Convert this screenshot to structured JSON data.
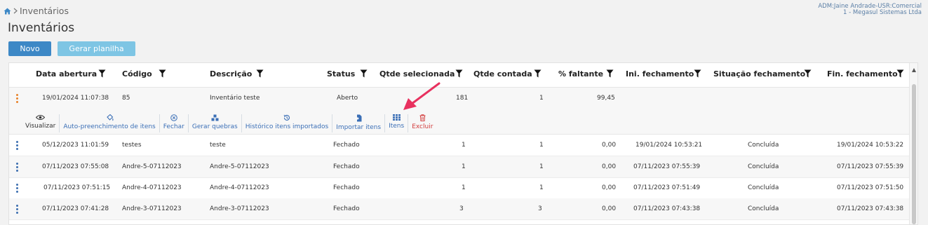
{
  "breadcrumb": {
    "page": "Inventários"
  },
  "user": {
    "line1": "ADM:Jaine Andrade-USR:Comercial",
    "line2": "1 - Megasul Sistemas Ltda"
  },
  "page_title": "Inventários",
  "buttons": {
    "novo": "Novo",
    "gerar_planilha": "Gerar planilha"
  },
  "table": {
    "columns": [
      "Data abertura",
      "Código",
      "Descrição",
      "Status",
      "Qtde selecionada",
      "Qtde contada",
      "% faltante",
      "Ini. fechamento",
      "Situação fechamento",
      "Fin. fechamento"
    ],
    "expanded_row": {
      "data_abertura": "19/01/2024 11:07:38",
      "codigo": "85",
      "descricao": "Inventário teste",
      "status": "Aberto",
      "qtde_selecionada": "181",
      "qtde_contada": "1",
      "faltante": "99,45",
      "actions": [
        "Visualizar",
        "Auto-preenchimento de itens",
        "Fechar",
        "Gerar quebras",
        "Histórico itens importados",
        "Importar itens",
        "Itens",
        "Excluir"
      ]
    },
    "rows": [
      {
        "data_abertura": "05/12/2023 11:01:59",
        "codigo": "testes",
        "descricao": "teste",
        "status": "Fechado",
        "qtde_selecionada": "1",
        "qtde_contada": "1",
        "faltante": "0,00",
        "ini_fechamento": "19/01/2024 10:53:21",
        "situacao": "Concluída",
        "fin_fechamento": "19/01/2024 10:53:22"
      },
      {
        "data_abertura": "07/11/2023 07:55:08",
        "codigo": "Andre-5-07112023",
        "descricao": "Andre-5-07112023",
        "status": "Fechado",
        "qtde_selecionada": "1",
        "qtde_contada": "1",
        "faltante": "0,00",
        "ini_fechamento": "07/11/2023 07:55:39",
        "situacao": "Concluída",
        "fin_fechamento": "07/11/2023 07:55:39"
      },
      {
        "data_abertura": "07/11/2023 07:51:15",
        "codigo": "Andre-4-07112023",
        "descricao": "Andre-4-07112023",
        "status": "Fechado",
        "qtde_selecionada": "1",
        "qtde_contada": "1",
        "faltante": "0,00",
        "ini_fechamento": "07/11/2023 07:51:49",
        "situacao": "Concluída",
        "fin_fechamento": "07/11/2023 07:51:50"
      },
      {
        "data_abertura": "07/11/2023 07:41:28",
        "codigo": "Andre-3-07112023",
        "descricao": "Andre-3-07112023",
        "status": "Fechado",
        "qtde_selecionada": "3",
        "qtde_contada": "3",
        "faltante": "0,00",
        "ini_fechamento": "07/11/2023 07:43:38",
        "situacao": "Concluída",
        "fin_fechamento": "07/11/2023 07:43:38"
      }
    ]
  },
  "colors": {
    "primary": "#3d88c6",
    "secondary": "#7ec5e4",
    "link": "#3b6fb6",
    "danger": "#d23c3c",
    "annotation": "#e8315f"
  }
}
